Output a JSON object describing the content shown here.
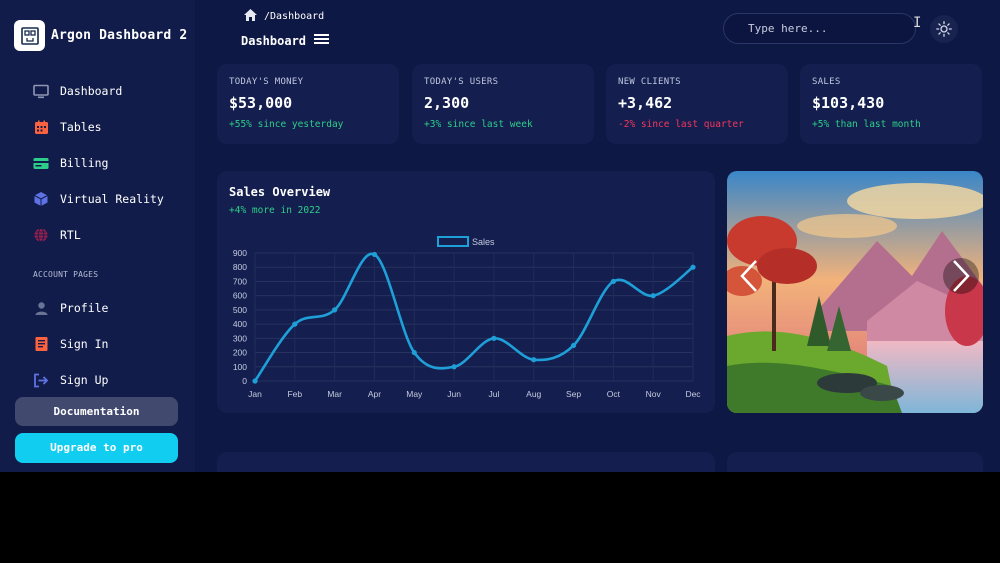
{
  "brand": {
    "name": "Argon Dashboard 2"
  },
  "sidebar": {
    "items": [
      {
        "label": "Dashboard",
        "icon": "monitor-icon",
        "color": "#8f96b3"
      },
      {
        "label": "Tables",
        "icon": "calendar-icon",
        "color": "#fb6340"
      },
      {
        "label": "Billing",
        "icon": "credit-card-icon",
        "color": "#2dce89"
      },
      {
        "label": "Virtual Reality",
        "icon": "cube-icon",
        "color": "#5e72e4"
      },
      {
        "label": "RTL",
        "icon": "globe-icon",
        "color": "#f5365c"
      }
    ],
    "section_label": "ACCOUNT PAGES",
    "account_items": [
      {
        "label": "Profile",
        "icon": "user-icon",
        "color": "#8f96b3"
      },
      {
        "label": "Sign In",
        "icon": "document-icon",
        "color": "#fb6340"
      },
      {
        "label": "Sign Up",
        "icon": "sign-up-icon",
        "color": "#5e72e4"
      }
    ],
    "doc_button": "Documentation",
    "pro_button": "Upgrade to pro"
  },
  "header": {
    "breadcrumb": "/Dashboard",
    "title": "Dashboard",
    "search_placeholder": "Type here..."
  },
  "stats": [
    {
      "label": "TODAY'S MONEY",
      "value": "$53,000",
      "change": "+55% since yesterday",
      "trend": "positive"
    },
    {
      "label": "TODAY'S USERS",
      "value": "2,300",
      "change": "+3% since last week",
      "trend": "positive"
    },
    {
      "label": "NEW CLIENTS",
      "value": "+3,462",
      "change": "-2% since last quarter",
      "trend": "negative"
    },
    {
      "label": "SALES",
      "value": "$103,430",
      "change": "+5% than last month",
      "trend": "positive"
    }
  ],
  "sales_overview": {
    "title": "Sales Overview",
    "subtitle": "+4% more in 2022"
  },
  "colors": {
    "background": "#0e1845",
    "card": "#141f4f",
    "accent": "#11cdef",
    "line": "#1f9fd8",
    "positive": "#2dce89",
    "negative": "#f5365c"
  },
  "chart_data": {
    "type": "line",
    "categories": [
      "Jan",
      "Feb",
      "Mar",
      "Apr",
      "May",
      "Jun",
      "Jul",
      "Aug",
      "Sep",
      "Oct",
      "Nov",
      "Dec"
    ],
    "series": [
      {
        "name": "Sales",
        "values": [
          0,
          400,
          500,
          890,
          200,
          100,
          300,
          150,
          250,
          700,
          600,
          800
        ]
      }
    ],
    "y_ticks": [
      0,
      100,
      200,
      300,
      400,
      500,
      600,
      700,
      800,
      900
    ],
    "ylim": [
      0,
      900
    ],
    "legend": "top-center",
    "grid": true
  }
}
